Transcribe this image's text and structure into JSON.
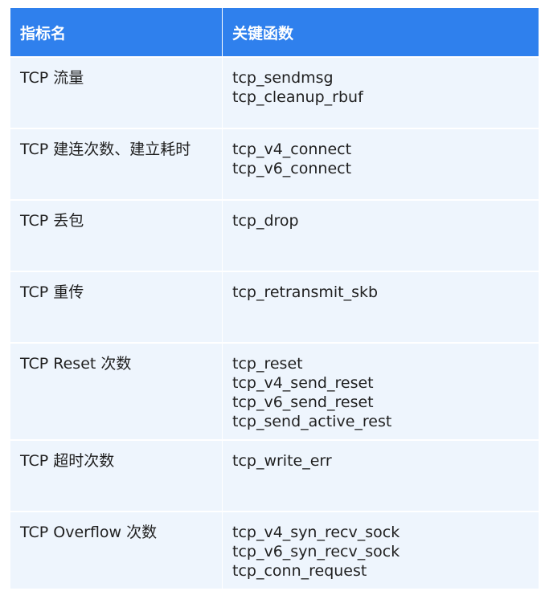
{
  "header": {
    "col1": "指标名",
    "col2": "关键函数"
  },
  "rows": [
    {
      "metric": "TCP 流量",
      "functions": [
        "tcp_sendmsg",
        "tcp_cleanup_rbuf"
      ]
    },
    {
      "metric": "TCP 建连次数、建立耗时",
      "functions": [
        "tcp_v4_connect",
        "tcp_v6_connect"
      ]
    },
    {
      "metric": "TCP 丢包",
      "functions": [
        "tcp_drop"
      ]
    },
    {
      "metric": "TCP 重传",
      "functions": [
        "tcp_retransmit_skb"
      ]
    },
    {
      "metric": "TCP Reset 次数",
      "functions": [
        "tcp_reset",
        "tcp_v4_send_reset",
        "tcp_v6_send_reset",
        "tcp_send_active_rest"
      ]
    },
    {
      "metric": "TCP 超时次数",
      "functions": [
        "tcp_write_err"
      ]
    },
    {
      "metric": "TCP Overflow 次数",
      "functions": [
        "tcp_v4_syn_recv_sock",
        "tcp_v6_syn_recv_sock",
        "tcp_conn_request"
      ]
    }
  ],
  "colors": {
    "header_bg": "#2f80ed",
    "row_bg": "#eef5fd"
  }
}
